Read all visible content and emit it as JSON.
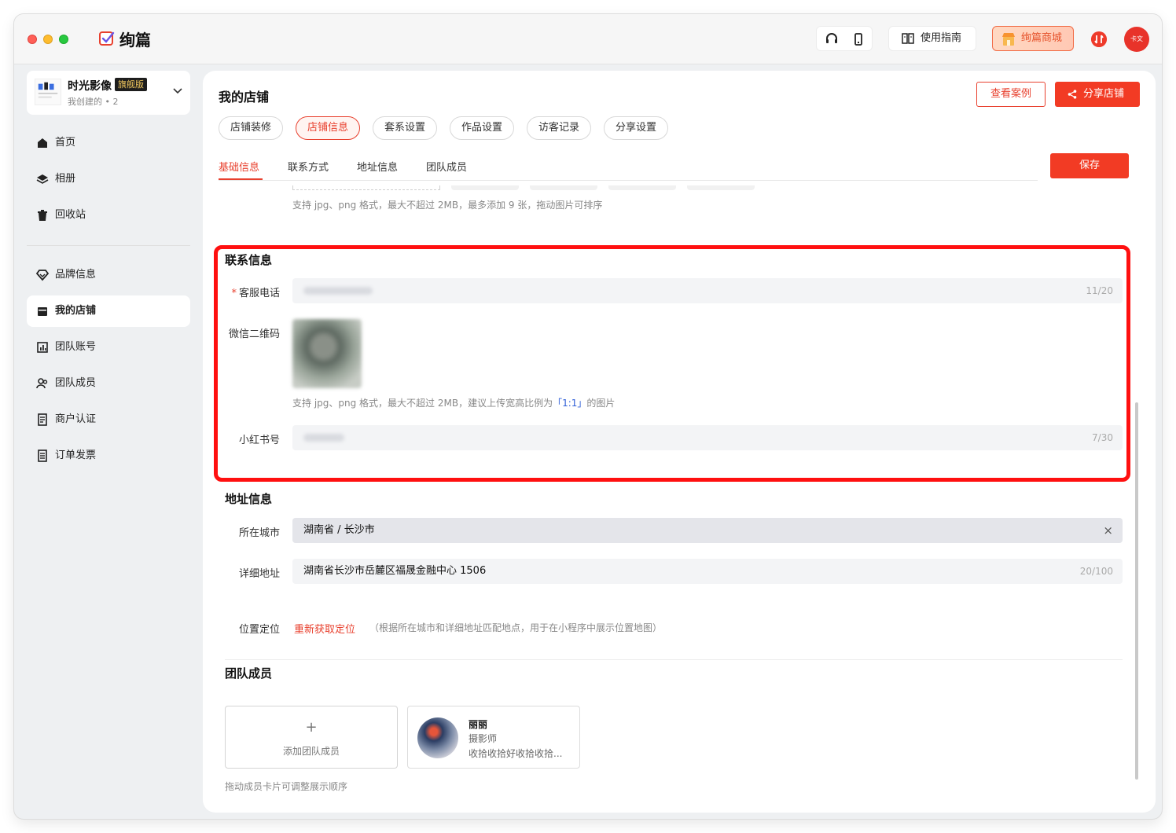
{
  "app": {
    "name": "绚篇",
    "guide_label": "使用指南",
    "mall_label": "绚篇商城",
    "avatar_text": "卡文"
  },
  "store": {
    "name": "时光影像",
    "badge": "旗舰版",
    "sub": "我创建的 • 2"
  },
  "nav": [
    {
      "label": "首页",
      "icon": "home-icon"
    },
    {
      "label": "相册",
      "icon": "layers-icon"
    },
    {
      "label": "回收站",
      "icon": "trash-icon"
    },
    {
      "label": "品牌信息",
      "icon": "diamond-icon"
    },
    {
      "label": "我的店铺",
      "icon": "store-icon",
      "active": true
    },
    {
      "label": "团队账号",
      "icon": "chart-icon"
    },
    {
      "label": "团队成员",
      "icon": "users-icon"
    },
    {
      "label": "商户认证",
      "icon": "doc-icon"
    },
    {
      "label": "订单发票",
      "icon": "invoice-icon"
    }
  ],
  "page": {
    "title": "我的店铺",
    "case_button": "查看案例",
    "share_button": "分享店铺",
    "save_button": "保存"
  },
  "pills": [
    "店铺装修",
    "店铺信息",
    "套系设置",
    "作品设置",
    "访客记录",
    "分享设置"
  ],
  "active_pill": "店铺信息",
  "tabs": [
    "基础信息",
    "联系方式",
    "地址信息",
    "团队成员"
  ],
  "active_tab": "基础信息",
  "gallery_hint": "支持 jpg、png 格式，最大不超过 2MB，最多添加 9 张，拖动图片可排序",
  "contact": {
    "title": "联系信息",
    "phone_label": "客服电话",
    "phone_count": "11/20",
    "wechat_label": "微信二维码",
    "wechat_hint_prefix": "支持 jpg、png 格式，最大不超过 2MB，建议上传宽高比例为",
    "wechat_hint_ratio": "「1:1」",
    "wechat_hint_suffix": "的图片",
    "xhs_label": "小红书号",
    "xhs_count": "7/30"
  },
  "address": {
    "title": "地址信息",
    "city_label": "所在城市",
    "city_value": "湖南省 / 长沙市",
    "clear_icon": "×",
    "detail_label": "详细地址",
    "detail_value": "湖南省长沙市岳麓区福晟金融中心 1506",
    "detail_count": "20/100",
    "locate_label": "位置定位",
    "locate_link": "重新获取定位",
    "locate_hint": "（根据所在城市和详细地址匹配地点，用于在小程序中展示位置地图）"
  },
  "team": {
    "title": "团队成员",
    "add_plus": "+",
    "add_label": "添加团队成员",
    "member": {
      "name": "丽丽",
      "role": "摄影师",
      "desc": "收拾收拾好收拾收拾..."
    },
    "hint": "拖动成员卡片可调整展示顺序"
  },
  "colors": {
    "accent": "#e8402e",
    "highlight": "#ff1010"
  }
}
